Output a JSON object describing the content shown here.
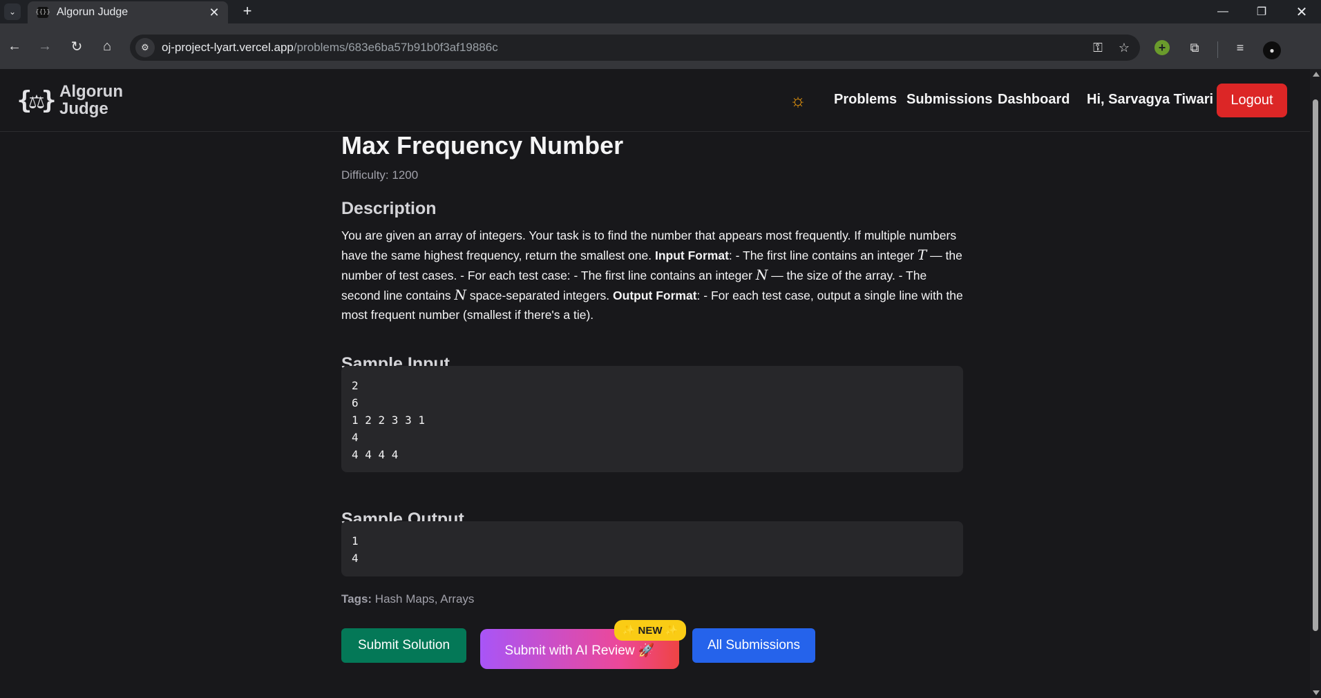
{
  "browser": {
    "tab_title": "Algorun Judge",
    "tab_favicon": "{{}}",
    "url_host": "oj-project-lyart.vercel.app",
    "url_path": "/problems/683e6ba57b91b0f3af19886c"
  },
  "navbar": {
    "logo_line1": "Algorun",
    "logo_line2": "Judge",
    "links": [
      "Problems",
      "Submissions",
      "Dashboard"
    ],
    "greeting": "Hi, Sarvagya Tiwari",
    "logout_label": "Logout"
  },
  "problem": {
    "title": "Max Frequency Number",
    "difficulty": "Difficulty: 1200",
    "description_heading": "Description",
    "description": {
      "p1": "You are given an array of integers. Your task is to find the number that appears most frequently. If multiple numbers have the same highest frequency, return the smallest one. ",
      "input_format_label": "Input Format",
      "p2": ": - The first line contains an integer ",
      "var_t": "T",
      "p3": " — the number of test cases. - For each test case: - The first line contains an integer ",
      "var_n1": "N",
      "p4": " — the size of the array. - The second line contains ",
      "var_n2": "N",
      "p5": " space-separated integers. ",
      "output_format_label": "Output Format",
      "p6": ": - For each test case, output a single line with the most frequent number (smallest if there's a tie)."
    },
    "sample_input_heading": "Sample Input",
    "sample_input": "2\n6\n1 2 2 3 3 1\n4\n4 4 4 4",
    "sample_output_heading": "Sample Output",
    "sample_output": "1\n4",
    "tags_label": "Tags:",
    "tags_value": " Hash Maps, Arrays"
  },
  "actions": {
    "submit_label": "Submit Solution",
    "ai_label": "Submit with AI Review 🚀",
    "new_badge": "✨ NEW ✨",
    "all_label": "All Submissions"
  },
  "icons": {
    "theme": "sun-icon",
    "back": "arrow-left-icon",
    "forward": "arrow-right-icon",
    "reload": "reload-icon",
    "home": "home-icon"
  },
  "colors": {
    "logout": "#dc2626",
    "submit": "#047857",
    "all_submissions": "#2563eb",
    "badge": "#facc15",
    "sun": "#f59e0b"
  }
}
